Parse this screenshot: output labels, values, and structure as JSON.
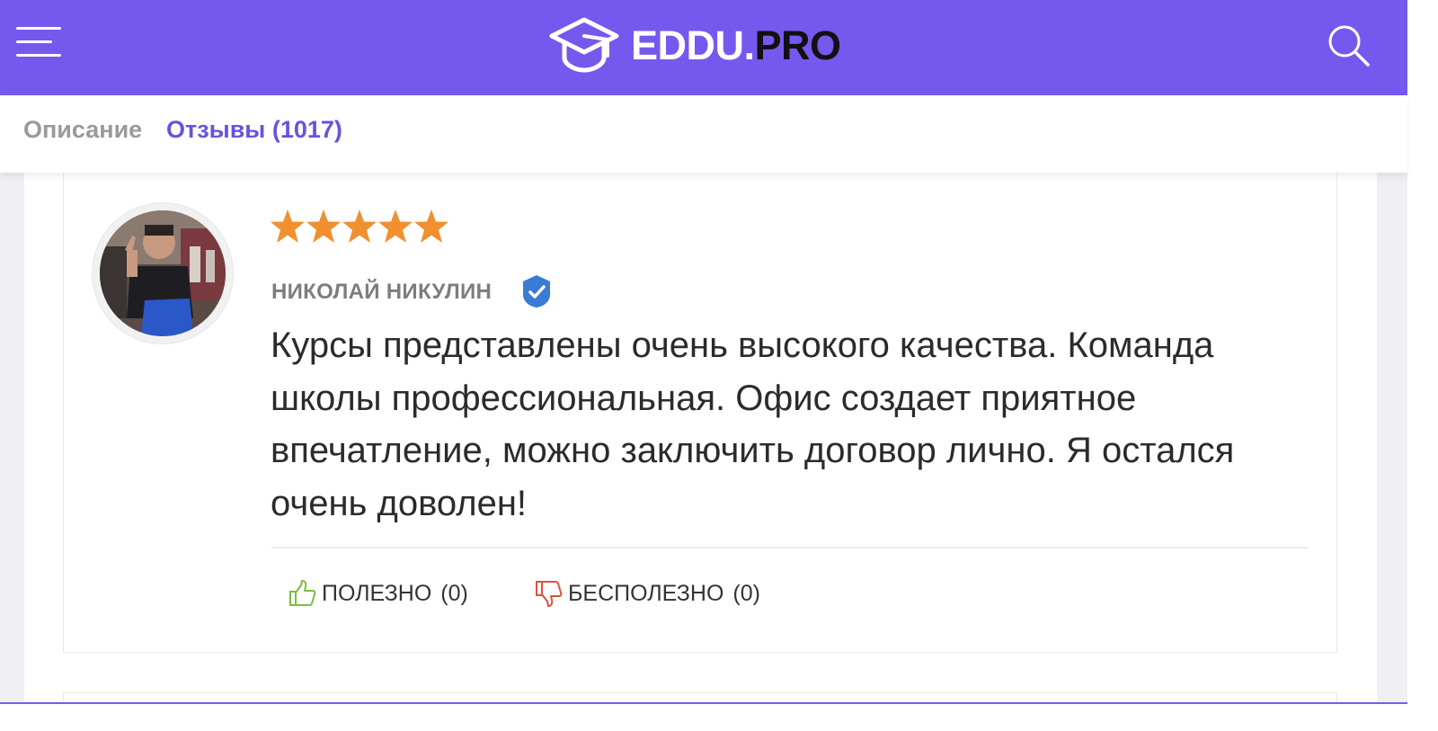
{
  "header": {
    "brand_primary": "EDDU.",
    "brand_secondary": "PRO",
    "menu_icon": "hamburger-menu-icon",
    "logo_icon": "graduation-cap-icon",
    "search_icon": "search-icon",
    "background_color": "#7559ee"
  },
  "tabs": [
    {
      "label": "Описание",
      "active": false
    },
    {
      "label": "Отзывы (1017)",
      "active": true
    }
  ],
  "review": {
    "rating": 5,
    "rating_max": 5,
    "star_color": "#f0902e",
    "author": "НИКОЛАЙ НИКУЛИН",
    "verified_icon": "verified-check-icon",
    "text": "Курсы представлены очень высокого качества. Команда школы профессиональная. Офис создает приятное впечатление, можно заключить договор лично. Я остался очень доволен!",
    "useful": {
      "label": "ПОЛЕЗНО",
      "count": "(0)",
      "icon": "thumbs-up-icon",
      "color": "#7cbd3c"
    },
    "useless": {
      "label": "БЕСПОЛЕЗНО",
      "count": "(0)",
      "icon": "thumbs-down-icon",
      "color": "#d9533c"
    }
  },
  "colors": {
    "accent": "#6a52dc",
    "verified_badge": "#3a7bd5"
  }
}
